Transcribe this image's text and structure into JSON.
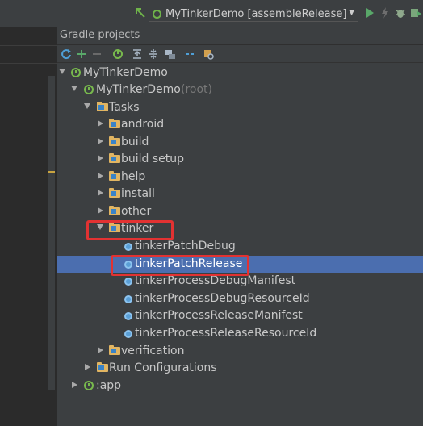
{
  "toolbar": {
    "run_config": "MyTinkerDemo [assembleRelease]",
    "icons": [
      "build-arrow-icon",
      "run-icon",
      "lightning-icon",
      "debug-icon",
      "coverage-icon"
    ]
  },
  "gradle_panel": {
    "title": "Gradle projects",
    "toolbar_icons": [
      "refresh-icon",
      "add-icon",
      "remove-icon",
      "execute-task-icon",
      "expand-all-icon",
      "collapse-all-icon",
      "link-icon",
      "offline-icon",
      "settings-icon"
    ]
  },
  "tree": {
    "project": "MyTinkerDemo",
    "module": "MyTinkerDemo",
    "module_suffix": "(root)",
    "tasks": "Tasks",
    "groups": {
      "android": "android",
      "build": "build",
      "build_setup": "build setup",
      "help": "help",
      "install": "install",
      "other": "other",
      "tinker": "tinker",
      "verification": "verification"
    },
    "tinker_tasks": [
      "tinkerPatchDebug",
      "tinkerPatchRelease",
      "tinkerProcessDebugManifest",
      "tinkerProcessDebugResourceId",
      "tinkerProcessReleaseManifest",
      "tinkerProcessReleaseResourceId"
    ],
    "run_configurations": "Run Configurations",
    "app": ":app",
    "selected": "tinkerPatchRelease"
  },
  "colors": {
    "selection": "#4b6eaf",
    "highlight_box": "#e23232",
    "panel_bg": "#3c3f41",
    "gradle_green": "#78b94d"
  }
}
